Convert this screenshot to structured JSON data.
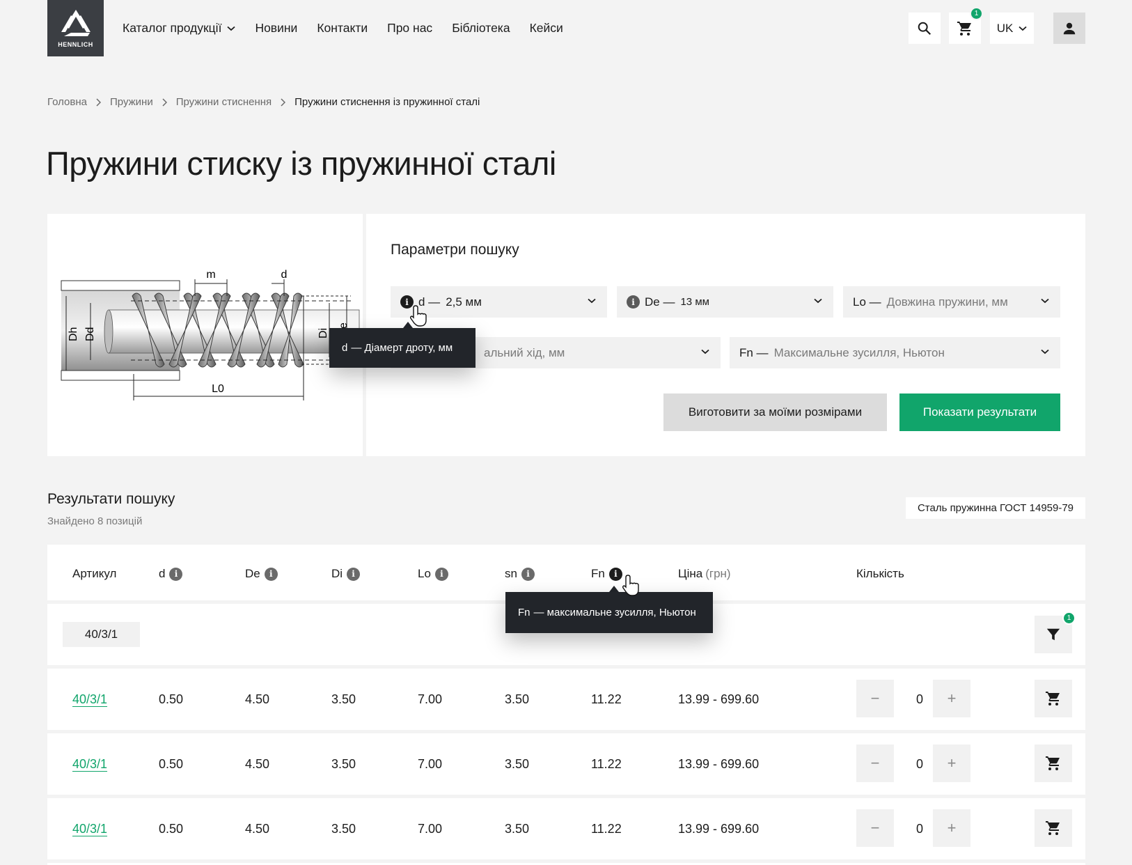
{
  "header": {
    "logo_text": "HENNLICH",
    "nav": [
      {
        "label": "Каталог продукції",
        "has_dropdown": true
      },
      {
        "label": "Новини"
      },
      {
        "label": "Контакти"
      },
      {
        "label": "Про нас"
      },
      {
        "label": "Бібліотека"
      },
      {
        "label": "Кейси"
      }
    ],
    "cart_count": "1",
    "language": "UK"
  },
  "breadcrumb": [
    "Головна",
    "Пружини",
    "Пружини стиснення",
    "Пружини стиснення із пружинної сталі"
  ],
  "page_title": "Пружини стиску із пружинної сталі",
  "diagram": {
    "labels": {
      "m": "m",
      "d": "d",
      "dh": "Dh",
      "dd": "Dd",
      "di": "Di",
      "l0": "L0",
      "de": "e"
    }
  },
  "search": {
    "title": "Параметри пошуку",
    "fields": [
      {
        "label": "d —",
        "value": "2,5 мм",
        "has_info": true
      },
      {
        "label": "De —",
        "value": "13 мм",
        "has_info": true
      },
      {
        "label": "Lo —",
        "placeholder": "Довжина пружини, мм"
      },
      {
        "label": "",
        "placeholder": "альний хід, мм"
      },
      {
        "label": "Fn —",
        "placeholder": "Максимальне зусилля, Ньютон"
      }
    ],
    "custom_button": "Виготовити за моїми розмірами",
    "submit_button": "Показати результати",
    "tooltip": {
      "key": "d",
      "text": "— Діамерт дроту, мм"
    }
  },
  "results": {
    "title": "Результати пошуку",
    "count_text": "Знайдено 8 позицій",
    "steel_tag": "Сталь пружинна ГОСТ 14959-79",
    "columns": [
      "Артикул",
      "d",
      "De",
      "Di",
      "Lo",
      "sn",
      "Fn",
      "Ціна",
      "(грн)",
      "Кількість"
    ],
    "tooltip": {
      "key": "Fn",
      "text": "— максимальне зусилля, Ньютон"
    },
    "filter_chip": "40/3/1",
    "filter_count": "1",
    "rows": [
      {
        "article": "40/3/1",
        "d": "0.50",
        "De": "4.50",
        "Di": "3.50",
        "Lo": "7.00",
        "sn": "3.50",
        "Fn": "11.22",
        "price": "13.99 - 699.60",
        "qty": "0"
      },
      {
        "article": "40/3/1",
        "d": "0.50",
        "De": "4.50",
        "Di": "3.50",
        "Lo": "7.00",
        "sn": "3.50",
        "Fn": "11.22",
        "price": "13.99 - 699.60",
        "qty": "0"
      },
      {
        "article": "40/3/1",
        "d": "0.50",
        "De": "4.50",
        "Di": "3.50",
        "Lo": "7.00",
        "sn": "3.50",
        "Fn": "11.22",
        "price": "13.99 - 699.60",
        "qty": "0"
      }
    ]
  },
  "colors": {
    "accent": "#11a56b",
    "dark": "#22252a",
    "logo_bg": "#3b3e43"
  },
  "icons": [
    "search-icon",
    "cart-icon",
    "chevron-down-icon",
    "user-icon",
    "info-icon",
    "filter-icon",
    "minus-icon",
    "plus-icon",
    "pointer-hand-icon"
  ]
}
